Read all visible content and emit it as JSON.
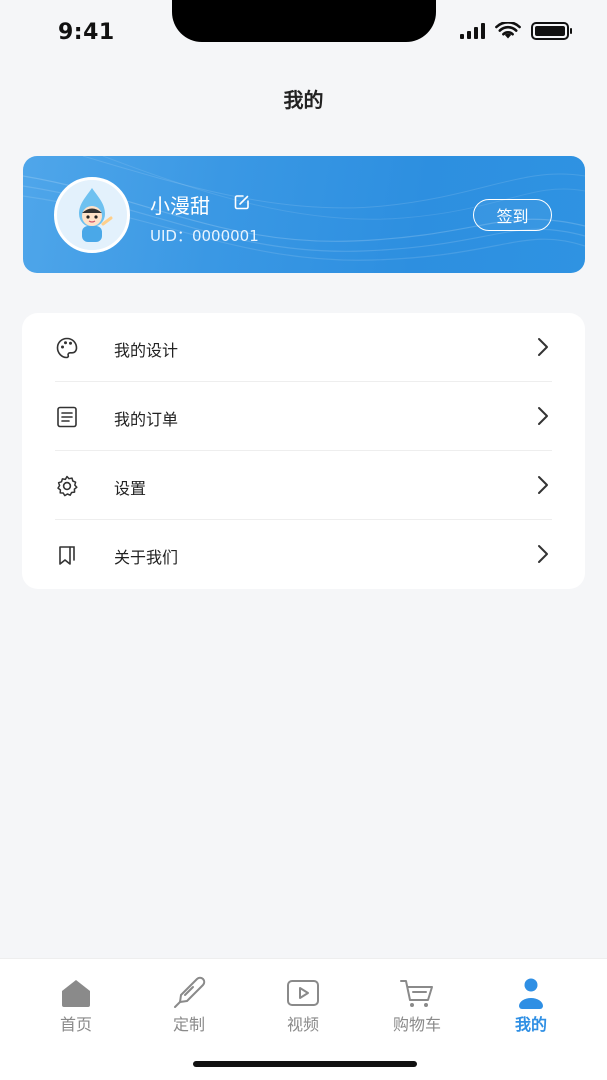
{
  "status_bar": {
    "time": "9:41"
  },
  "header": {
    "title": "我的"
  },
  "profile": {
    "name": "小漫甜",
    "uid": "UID：0000001",
    "signin_label": "签到"
  },
  "menu": {
    "items": [
      {
        "label": "我的设计",
        "icon": "palette-icon"
      },
      {
        "label": "我的订单",
        "icon": "document-icon"
      },
      {
        "label": "设置",
        "icon": "gear-icon"
      },
      {
        "label": "关于我们",
        "icon": "bookmark-icon"
      }
    ]
  },
  "tabbar": {
    "items": [
      {
        "label": "首页",
        "icon": "home-icon"
      },
      {
        "label": "定制",
        "icon": "brush-icon"
      },
      {
        "label": "视频",
        "icon": "video-icon"
      },
      {
        "label": "购物车",
        "icon": "cart-icon"
      },
      {
        "label": "我的",
        "icon": "user-icon"
      }
    ],
    "active_index": 4
  },
  "colors": {
    "accent": "#2f8fe4",
    "card_gradient_start": "#4fa6ea",
    "card_gradient_end": "#2d8fe0",
    "background": "#f5f6f8",
    "inactive_tab": "#8a8a8a"
  }
}
